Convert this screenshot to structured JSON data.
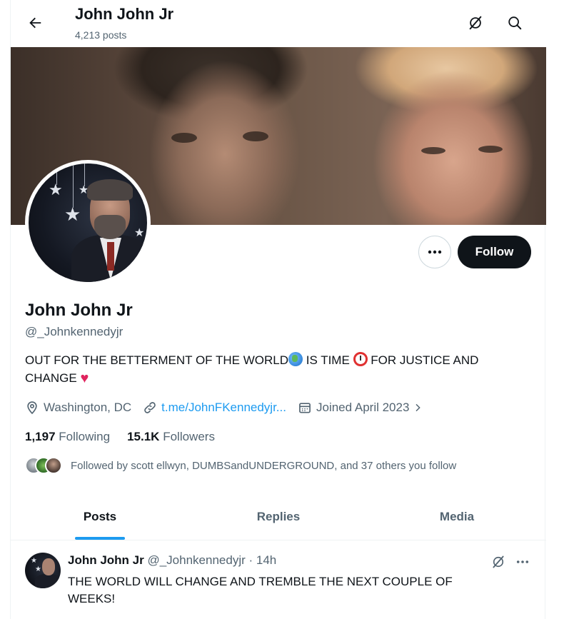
{
  "header": {
    "title": "John John Jr",
    "post_count": "4,213 posts"
  },
  "profile": {
    "name": "John John Jr",
    "handle": "@_Johnkennedyjr",
    "bio_part1": "OUT FOR THE BETTERMENT OF THE WORLD",
    "bio_part2": " IS TIME ",
    "bio_part3": " FOR JUSTICE AND CHANGE ",
    "location": "Washington, DC",
    "link": "t.me/JohnFKennedyjr...",
    "joined": "Joined April 2023",
    "following_count": "1,197",
    "following_label": "Following",
    "followers_count": "15.1K",
    "followers_label": "Followers",
    "followed_by": "Followed by scott ellwyn, DUMBSandUNDERGROUND, and 37 others you follow"
  },
  "actions": {
    "follow_label": "Follow"
  },
  "tabs": [
    {
      "label": "Posts",
      "active": true
    },
    {
      "label": "Replies",
      "active": false
    },
    {
      "label": "Media",
      "active": false
    }
  ],
  "tweet": {
    "name": "John John Jr",
    "handle": "@_Johnkennedyjr",
    "sep": " · ",
    "time": "14h",
    "text": "THE WORLD WILL CHANGE AND TREMBLE THE NEXT COUPLE OF WEEKS!"
  },
  "colors": {
    "accent": "#1d9bf0",
    "text_primary": "#0f1419",
    "text_secondary": "#536471",
    "follow_bg": "#0f1419"
  },
  "icons": [
    "back-arrow-icon",
    "grok-icon",
    "search-icon",
    "more-icon",
    "location-icon",
    "link-icon",
    "calendar-icon",
    "chevron-right-icon"
  ]
}
